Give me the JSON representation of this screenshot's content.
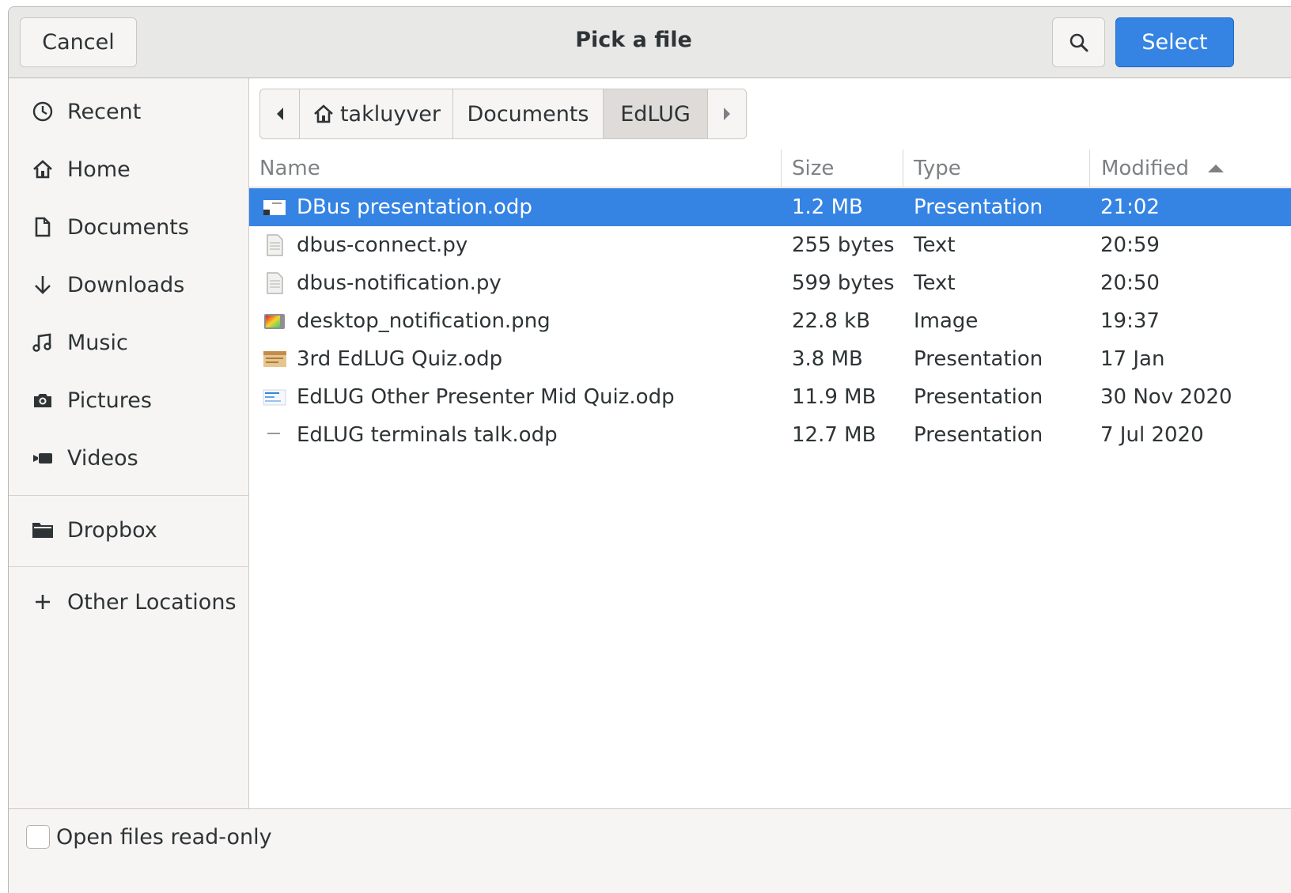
{
  "dialog": {
    "title": "Pick a file",
    "cancel_label": "Cancel",
    "select_label": "Select",
    "search_icon": "search-icon"
  },
  "sidebar": {
    "items": [
      {
        "label": "Recent",
        "icon": "clock-icon"
      },
      {
        "label": "Home",
        "icon": "home-icon"
      },
      {
        "label": "Documents",
        "icon": "document-icon"
      },
      {
        "label": "Downloads",
        "icon": "download-arrow-icon"
      },
      {
        "label": "Music",
        "icon": "music-note-icon"
      },
      {
        "label": "Pictures",
        "icon": "camera-icon"
      },
      {
        "label": "Videos",
        "icon": "video-camera-icon"
      },
      {
        "label": "Dropbox",
        "icon": "folder-icon"
      },
      {
        "label": "Other Locations",
        "icon": "plus-icon"
      }
    ]
  },
  "pathbar": {
    "crumbs": [
      "takluyver",
      "Documents",
      "EdLUG"
    ],
    "active": "EdLUG"
  },
  "file_list": {
    "columns": [
      "Name",
      "Size",
      "Type",
      "Modified"
    ],
    "sort_column": "Modified",
    "sort_direction": "ascending",
    "rows": [
      {
        "name": "DBus presentation.odp",
        "size": "1.2 MB",
        "type": "Presentation",
        "modified": "21:02",
        "selected": true,
        "icon": "presentation-thumbnail-icon"
      },
      {
        "name": "dbus-connect.py",
        "size": "255 bytes",
        "type": "Text",
        "modified": "20:59",
        "selected": false,
        "icon": "text-file-icon"
      },
      {
        "name": "dbus-notification.py",
        "size": "599 bytes",
        "type": "Text",
        "modified": "20:50",
        "selected": false,
        "icon": "text-file-icon"
      },
      {
        "name": "desktop_notification.png",
        "size": "22.8 kB",
        "type": "Image",
        "modified": "19:37",
        "selected": false,
        "icon": "image-thumbnail-icon"
      },
      {
        "name": "3rd EdLUG Quiz.odp",
        "size": "3.8 MB",
        "type": "Presentation",
        "modified": "17 Jan",
        "selected": false,
        "icon": "presentation-thumbnail-icon"
      },
      {
        "name": "EdLUG Other Presenter Mid Quiz.odp",
        "size": "11.9 MB",
        "type": "Presentation",
        "modified": "30 Nov 2020",
        "selected": false,
        "icon": "presentation-thumbnail-icon"
      },
      {
        "name": "EdLUG terminals talk.odp",
        "size": "12.7 MB",
        "type": "Presentation",
        "modified": "7 Jul 2020",
        "selected": false,
        "icon": "presentation-thumbnail-icon"
      }
    ]
  },
  "footer": {
    "readonly_label": "Open files read-only",
    "readonly_checked": false
  },
  "colors": {
    "accent": "#3584e4",
    "headerbar": "#e8e8e7",
    "sidebar": "#f6f5f4"
  }
}
